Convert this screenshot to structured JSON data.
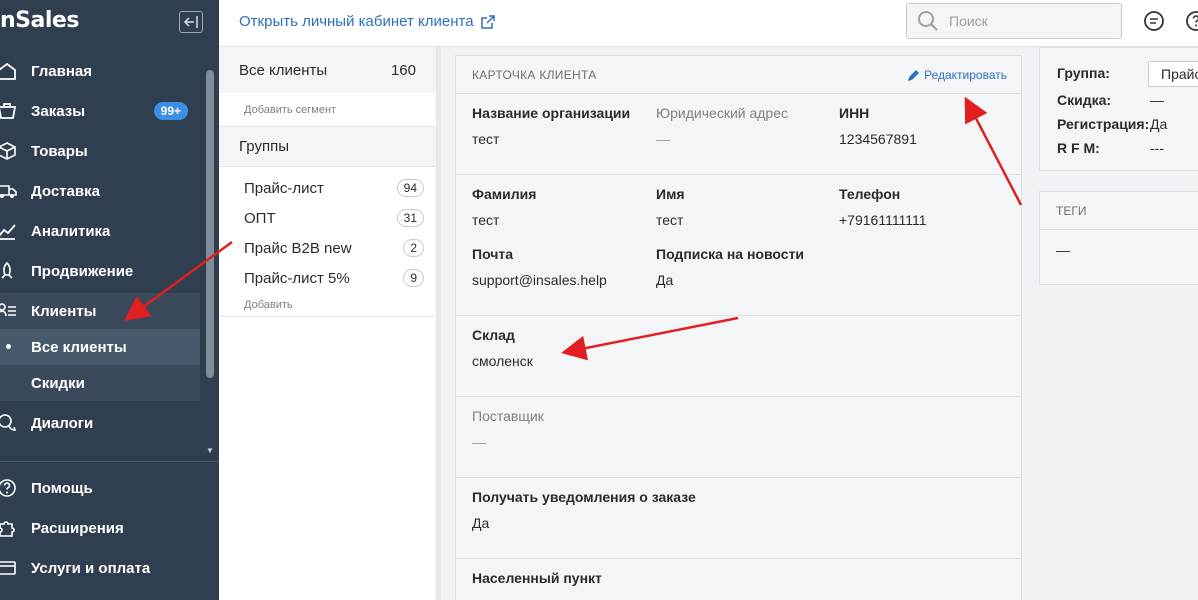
{
  "sidebar": {
    "logo": "nSales",
    "items": [
      {
        "label": "Главная",
        "icon": "home-icon"
      },
      {
        "label": "Заказы",
        "icon": "cart-icon",
        "badge": "99+"
      },
      {
        "label": "Товары",
        "icon": "box-icon"
      },
      {
        "label": "Доставка",
        "icon": "truck-icon"
      },
      {
        "label": "Аналитика",
        "icon": "chart-icon"
      },
      {
        "label": "Продвижение",
        "icon": "rocket-icon"
      },
      {
        "label": "Клиенты",
        "icon": "users-list-icon"
      },
      {
        "label": "Диалоги",
        "icon": "chat-bubbles-icon"
      }
    ],
    "clients_sub": [
      "Все клиенты",
      "Скидки"
    ],
    "bottom_items": [
      {
        "label": "Помощь",
        "icon": "help-icon"
      },
      {
        "label": "Расширения",
        "icon": "puzzle-icon"
      },
      {
        "label": "Услуги и оплата",
        "icon": "billing-icon"
      }
    ]
  },
  "topbar": {
    "open_cabinet": "Открыть личный кабинет клиента",
    "search_placeholder": "Поиск"
  },
  "segments": {
    "all_label": "Все клиенты",
    "all_count": "160",
    "add_segment": "Добавить сегмент",
    "groups_title": "Группы",
    "groups": [
      {
        "name": "Прайс-лист",
        "count": "94"
      },
      {
        "name": "ОПТ",
        "count": "31"
      },
      {
        "name": "Прайс B2B new",
        "count": "2"
      },
      {
        "name": "Прайс-лист 5%",
        "count": "9"
      }
    ],
    "add_group": "Добавить"
  },
  "card": {
    "title": "КАРТОЧКА КЛИЕНТА",
    "edit": "Редактировать",
    "org_name_label": "Название организации",
    "org_name_value": "тест",
    "legal_address_label": "Юридический адрес",
    "legal_address_value": "—",
    "inn_label": "ИНН",
    "inn_value": "1234567891",
    "surname_label": "Фамилия",
    "surname_value": "тест",
    "name_label": "Имя",
    "name_value": "тест",
    "phone_label": "Телефон",
    "phone_value": "+79161111111",
    "email_label": "Почта",
    "email_value": "support@insales.help",
    "subscription_label": "Подписка на новости",
    "subscription_value": "Да",
    "warehouse_label": "Склад",
    "warehouse_value": "смоленск",
    "supplier_label": "Поставщик",
    "supplier_value": "—",
    "order_notify_label": "Получать уведомления о заказе",
    "order_notify_value": "Да",
    "locality_label": "Населенный пункт"
  },
  "info": {
    "group_label": "Группа:",
    "group_value": "Прайс",
    "discount_label": "Скидка:",
    "discount_value": "—",
    "registration_label": "Регистрация:",
    "registration_value": "Да",
    "rfm_label": "R F M:",
    "rfm_value": "---"
  },
  "tags": {
    "title": "ТЕГИ",
    "value": "—"
  },
  "colors": {
    "sidebar_bg": "#2f3f4f",
    "link": "#2f6fc1",
    "badge": "#3d8ee8",
    "annotation_arrow": "#e02020"
  }
}
